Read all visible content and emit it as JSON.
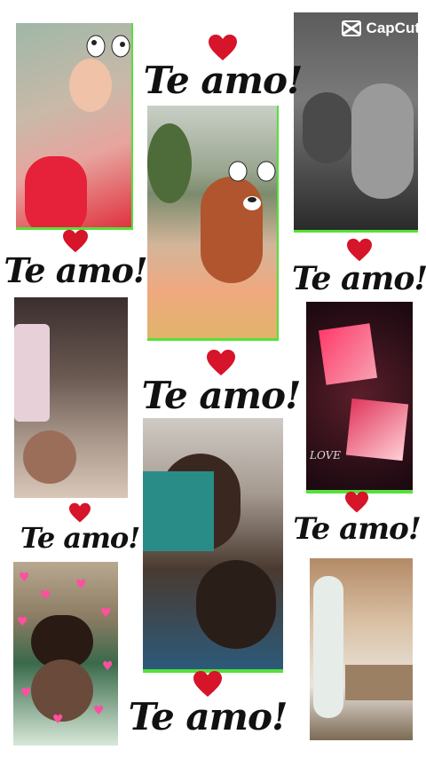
{
  "watermark": {
    "brand": "CapCut"
  },
  "captions": {
    "c1": "Te amo!",
    "c2": "Te amo!",
    "c3": "Te amo!",
    "c4": "Te amo!",
    "c5": "Te amo!",
    "c6": "Te amo!",
    "c7": "Te amo!"
  },
  "photo_texts": {
    "love_label": "LOVE"
  },
  "colors": {
    "heart": "#d6142a",
    "frame_accent": "#55e03a",
    "caption_text": "#111111"
  },
  "icons": [
    "heart-icon",
    "capcut-logo-icon",
    "dog-filter-sticker"
  ]
}
